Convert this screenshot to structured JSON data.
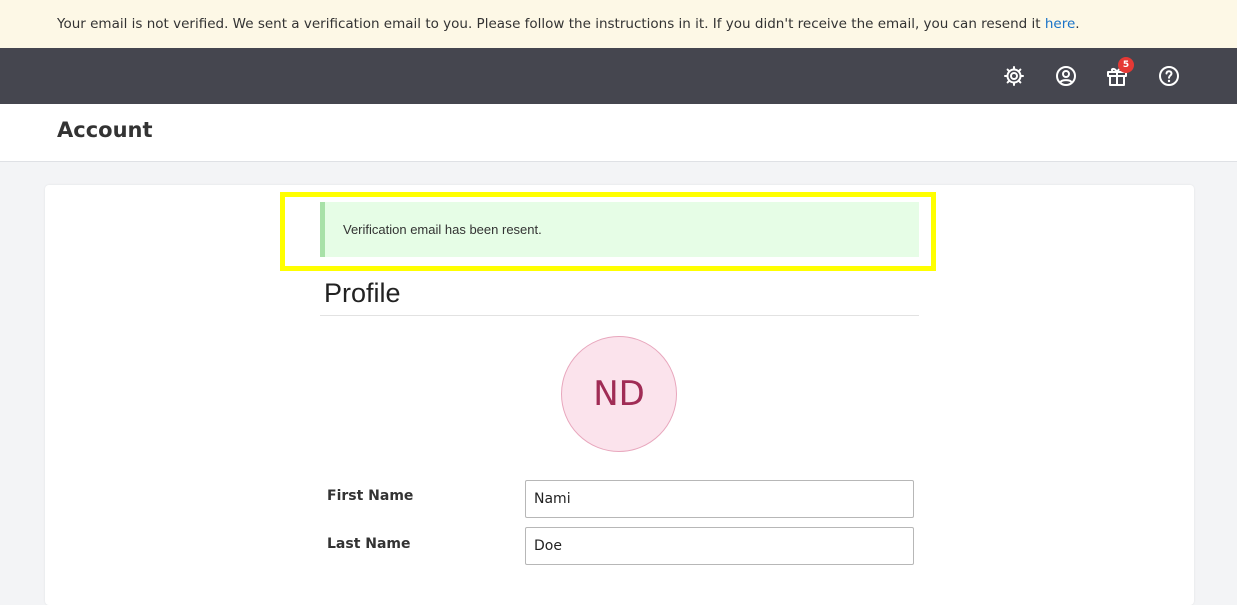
{
  "verification_banner": {
    "message": "Your email is not verified. We sent a verification email to you. Please follow the instructions in it. If you didn't receive the email, you can resend it ",
    "link_text": "here",
    "trailing": "."
  },
  "topbar": {
    "icons": [
      "settings-icon",
      "account-circle-icon",
      "gift-icon",
      "help-icon"
    ],
    "gift_badge": "5",
    "background": "#45464f",
    "badge_color": "#e53935"
  },
  "page": {
    "title": "Account"
  },
  "alert": {
    "message": "Verification email has been resent.",
    "background": "#e6fde6",
    "highlight_color": "#ffff00"
  },
  "profile": {
    "heading": "Profile",
    "avatar_initials": "ND",
    "avatar_color": "#a02c55",
    "fields": {
      "first_name": {
        "label": "First Name",
        "value": "Nami"
      },
      "last_name": {
        "label": "Last Name",
        "value": "Doe"
      }
    }
  }
}
